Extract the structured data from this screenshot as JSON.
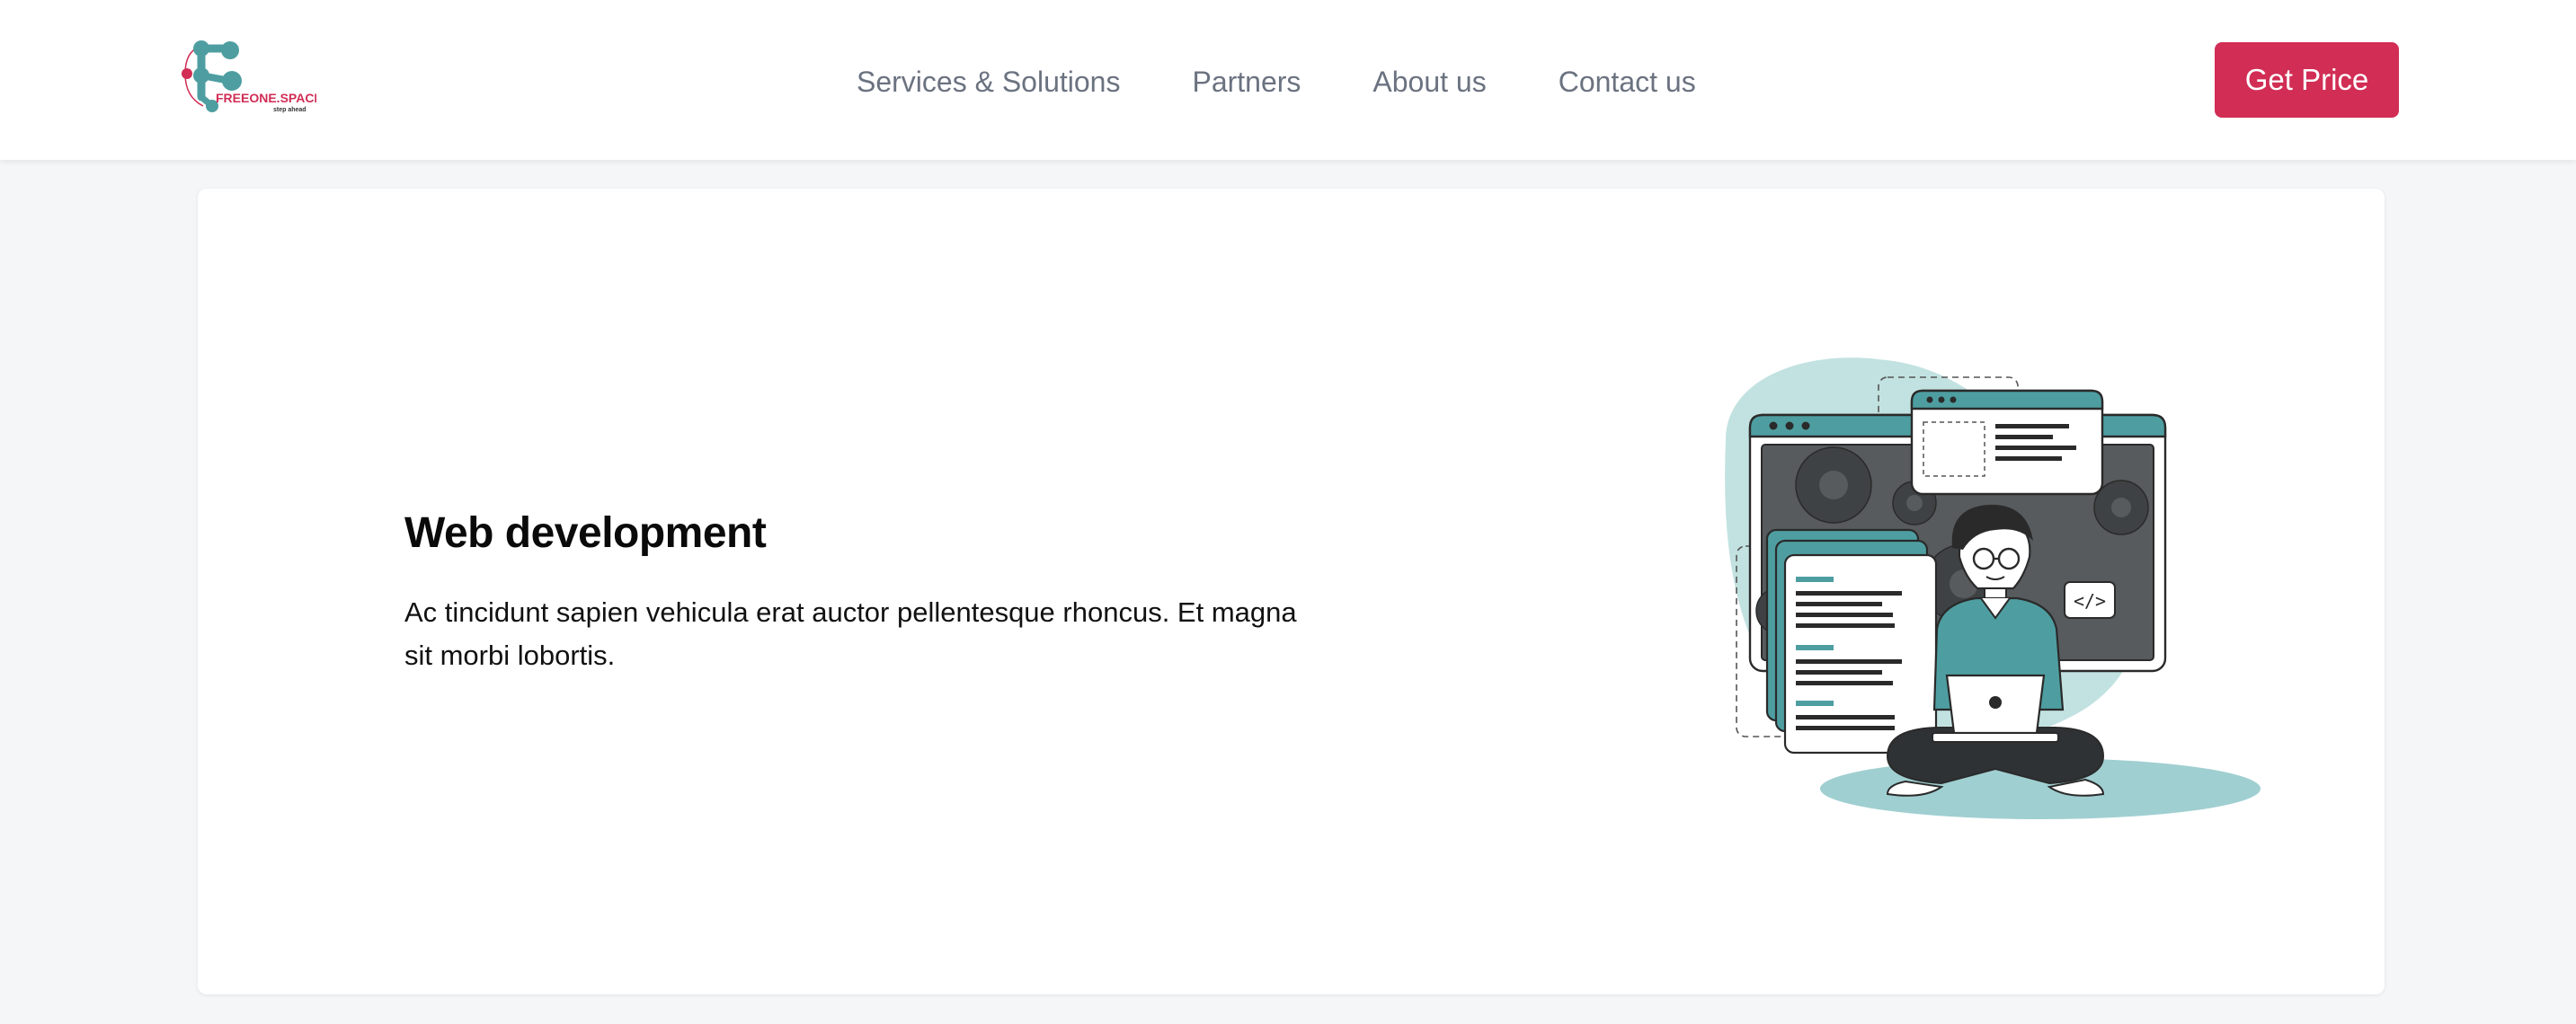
{
  "header": {
    "logo": {
      "brand_name": "FREEONE.SPACE",
      "tagline": "step ahead",
      "icon": "logo-mark-icon"
    },
    "nav": [
      {
        "label": "Services & Solutions"
      },
      {
        "label": "Partners"
      },
      {
        "label": "About us"
      },
      {
        "label": "Contact us"
      }
    ],
    "cta_label": "Get Price"
  },
  "card": {
    "title": "Web development",
    "description": "Ac tincidunt sapien vehicula erat auctor pellentesque rhoncus. Et magna sit morbi lobortis.",
    "illustration": "developer-with-laptop-illustration"
  },
  "colors": {
    "accent": "#d12d55",
    "teal": "#4e9ea1",
    "teal_light": "#c2e2e1",
    "nav_text": "#6b7280",
    "background": "#f5f6f8"
  }
}
